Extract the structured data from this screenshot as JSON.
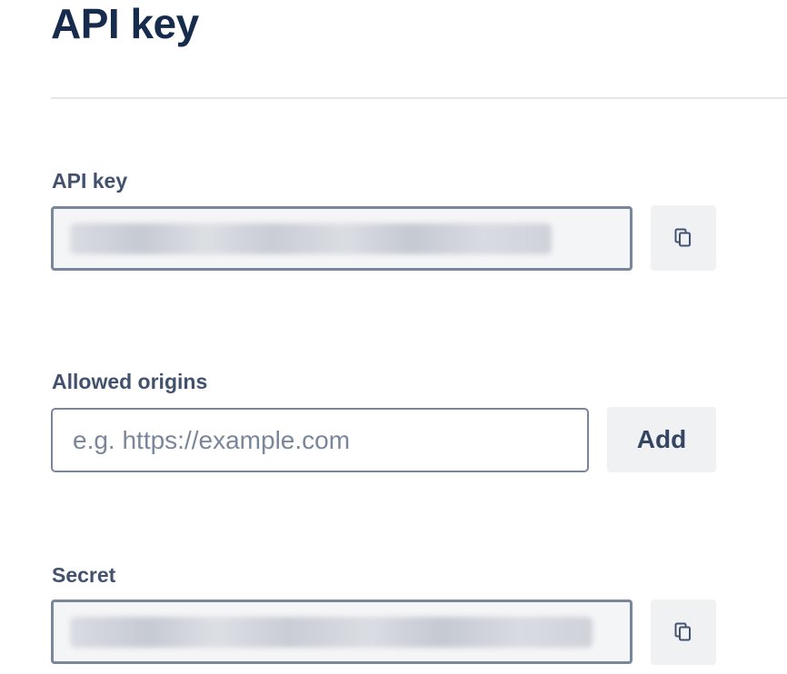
{
  "page": {
    "title": "API key"
  },
  "api_key": {
    "label": "API key",
    "value": "•••••••••••••••••••••••••••••••••••",
    "copy_icon": "copy-icon"
  },
  "allowed_origins": {
    "label": "Allowed origins",
    "placeholder": "e.g. https://example.com",
    "value": "",
    "add_label": "Add"
  },
  "secret": {
    "label": "Secret",
    "value": "••••••••••••••••••••••••••••••••••••••",
    "copy_icon": "copy-icon"
  },
  "colors": {
    "heading": "#172b4d",
    "label": "#42526e",
    "border": "#7a869a",
    "field_bg": "#f4f5f7",
    "button_bg": "#f0f1f3"
  }
}
